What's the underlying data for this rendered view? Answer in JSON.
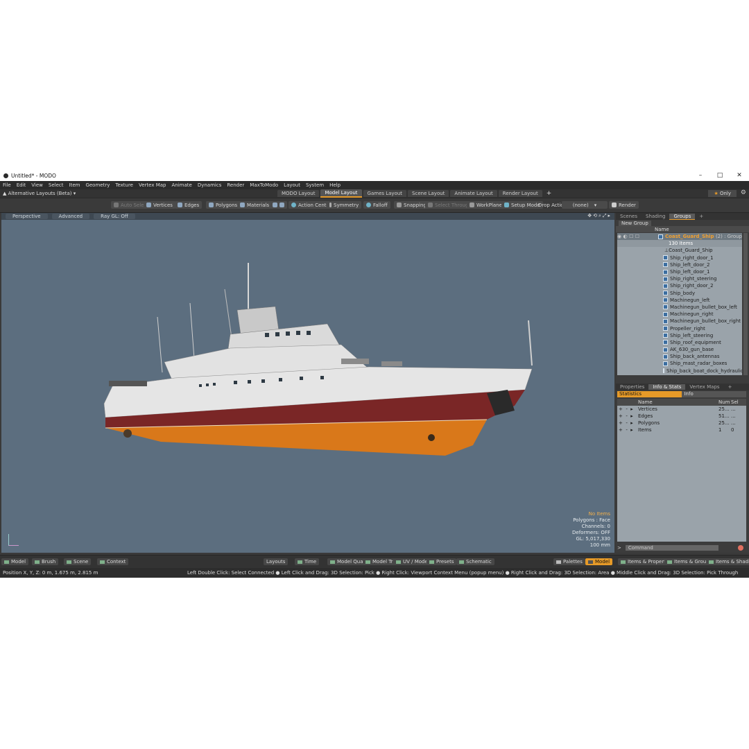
{
  "window": {
    "title": "Untitled* - MODO"
  },
  "menu": [
    "File",
    "Edit",
    "View",
    "Select",
    "Item",
    "Geometry",
    "Texture",
    "Vertex Map",
    "Animate",
    "Dynamics",
    "Render",
    "MaxToModo",
    "Layout",
    "System",
    "Help"
  ],
  "layouts": {
    "alt_label": "Alternative Layouts (Beta)",
    "tabs": [
      "MODO Layout",
      "Model Layout",
      "Games Layout",
      "Scene Layout",
      "Animate Layout",
      "Render Layout"
    ],
    "active": "Model Layout",
    "only": "Only"
  },
  "toolbar": {
    "auto_select": "Auto Select",
    "vertices": "Vertices",
    "edges": "Edges",
    "polygons": "Polygons",
    "materials": "Materials",
    "action_center": "Action Center",
    "symmetry": "Symmetry",
    "falloff": "Falloff",
    "snapping": "Snapping",
    "select_through": "Select Through",
    "workplane": "WorkPlane",
    "setup_mode": "Setup Mode",
    "drop_action": "Drop Action",
    "drop_value": "(none)",
    "render": "Render"
  },
  "viewport": {
    "view": "Perspective",
    "shading": "Advanced",
    "raygl": "Ray GL: Off",
    "info": [
      "No Items",
      "Polygons : Face",
      "Channels: 0",
      "Deformers: OFF",
      "GL: 5,017,330",
      "100 mm"
    ]
  },
  "groups_panel": {
    "tabs": [
      "Scenes",
      "Shading",
      "Groups"
    ],
    "active": "Groups",
    "new_group": "New Group",
    "col_name": "Name",
    "group_name": "Coast_Guard_Ship",
    "group_suffix": "(2) : Group",
    "item_count": "130 Items",
    "items": [
      "Coast_Guard_Ship",
      "Ship_right_door_1",
      "Ship_left_door_2",
      "Ship_left_door_1",
      "Ship_right_steering",
      "Ship_right_door_2",
      "Ship_body",
      "Machinegun_left",
      "Machinegun_bullet_box_left",
      "Machinegun_right",
      "Machinegun_bullet_box_right",
      "Propeller_right",
      "Ship_left_steering",
      "Ship_roof_equipment",
      "AK_630_gun_base",
      "Ship_back_antennas",
      "Ship_mast_radar_boxes",
      "Ship_back_boat_dock_hydraulic_el..."
    ]
  },
  "info_panel": {
    "tabs": [
      "Properties",
      "Info & Stats",
      "Vertex Maps"
    ],
    "active": "Info & Stats",
    "sub_tabs": [
      "Statistics",
      "Info"
    ],
    "cols": [
      "Name",
      "Num",
      "Sel"
    ],
    "rows": [
      {
        "name": "Vertices",
        "num": "25...",
        "sel": "..."
      },
      {
        "name": "Edges",
        "num": "51...",
        "sel": "..."
      },
      {
        "name": "Polygons",
        "num": "25...",
        "sel": "..."
      },
      {
        "name": "Items",
        "num": "1",
        "sel": "0"
      }
    ],
    "command_placeholder": "Command"
  },
  "bottombar": {
    "model": "Model",
    "brush": "Brush",
    "scene": "Scene",
    "context": "Context",
    "layouts": "Layouts",
    "time": "Time",
    "model_quad": "Model Quad",
    "model_tri": "Model Tri",
    "uv_model": "UV / Model",
    "presets": "Presets",
    "schematic": "Schematic",
    "palettes": "Palettes",
    "model_active": "Model",
    "items_props": "Items & Properties",
    "items_groups": "Items & Groups",
    "items_shading": "Items & Shading"
  },
  "status": {
    "position": "Position X, Y, Z:    0 m, 1.675 m, 2.815 m",
    "hint": "Left Double Click: Select Connected ● Left Click and Drag: 3D Selection: Pick ● Right Click: Viewport Context Menu (popup menu) ● Right Click and Drag: 3D Selection: Area ● Middle Click and Drag: 3D Selection: Pick Through"
  },
  "colors": {
    "accent": "#e69a28",
    "viewport_bg": "#5c6e7f",
    "hull_red": "#7a2626",
    "hull_orange": "#d9781a"
  }
}
